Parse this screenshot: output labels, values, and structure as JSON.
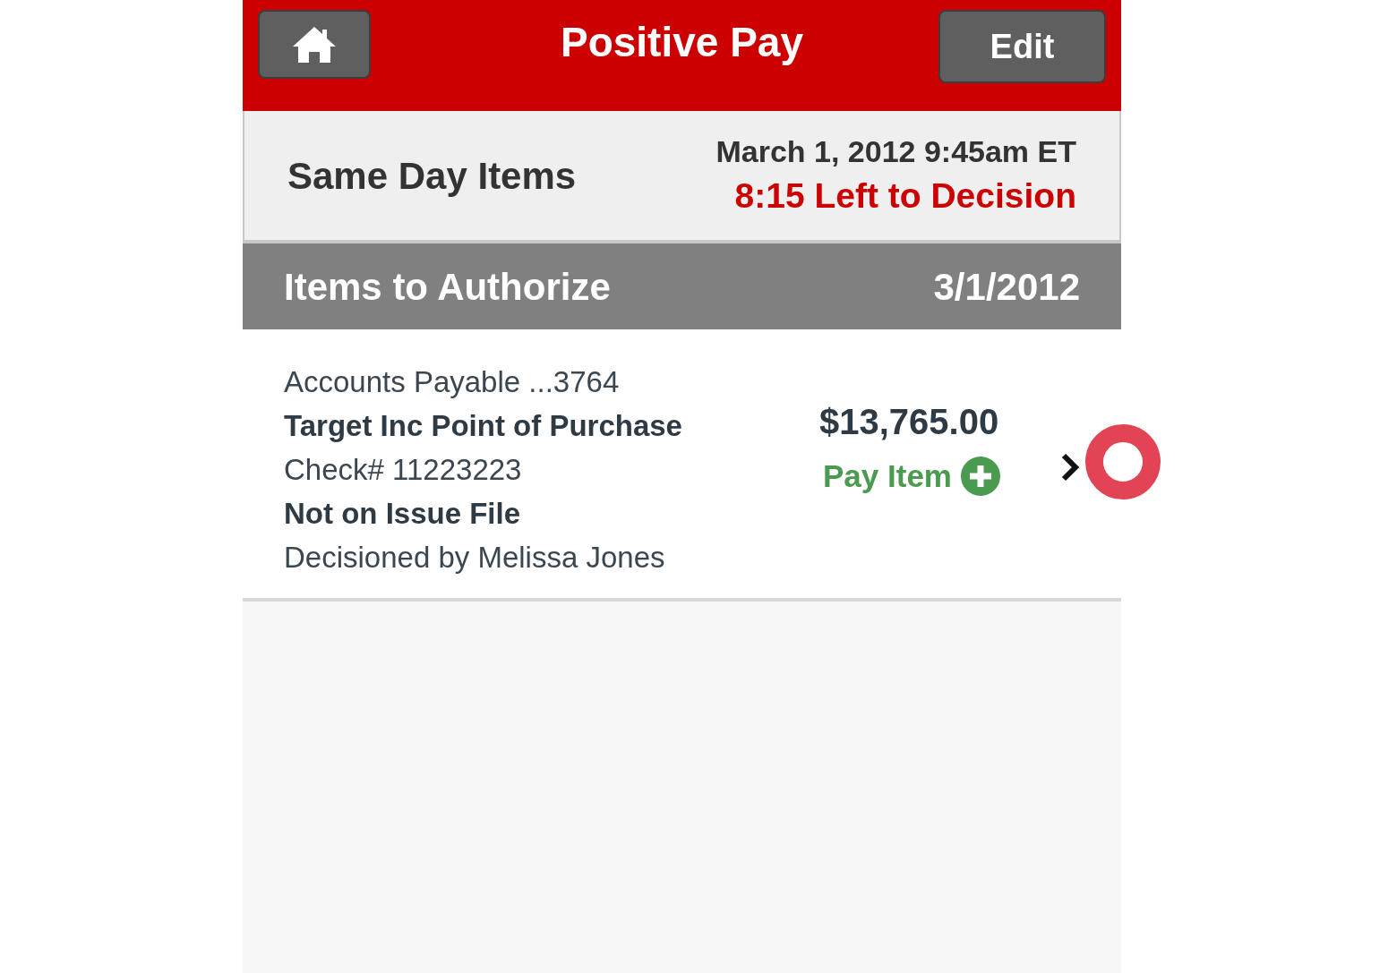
{
  "header": {
    "title": "Positive Pay",
    "edit_button": "Edit"
  },
  "summary": {
    "title": "Same Day Items",
    "date": "March 1, 2012 9:45am ET",
    "countdown": "8:15 Left to Decision"
  },
  "section": {
    "title": "Items to Authorize",
    "date": "3/1/2012"
  },
  "items": [
    {
      "lines": [
        {
          "text": "Accounts Payable ...3764",
          "bold": false
        },
        {
          "text": "Target Inc Point of Purchase",
          "bold": true
        },
        {
          "text": "Check# 11223223",
          "bold": false
        },
        {
          "text": "Not on Issue File",
          "bold": true
        },
        {
          "text": "Decisioned by Melissa Jones",
          "bold": false
        }
      ],
      "amount": "$13,765.00",
      "action": "Pay Item"
    }
  ]
}
